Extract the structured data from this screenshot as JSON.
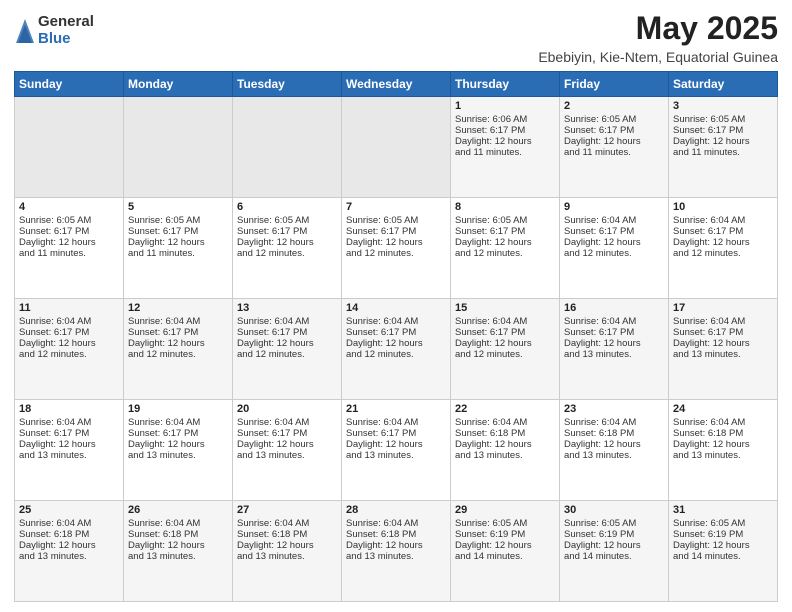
{
  "logo": {
    "general": "General",
    "blue": "Blue"
  },
  "title": "May 2025",
  "location": "Ebebiyin, Kie-Ntem, Equatorial Guinea",
  "days_of_week": [
    "Sunday",
    "Monday",
    "Tuesday",
    "Wednesday",
    "Thursday",
    "Friday",
    "Saturday"
  ],
  "weeks": [
    [
      {
        "day": "",
        "info": ""
      },
      {
        "day": "",
        "info": ""
      },
      {
        "day": "",
        "info": ""
      },
      {
        "day": "",
        "info": ""
      },
      {
        "day": "1",
        "info": "Sunrise: 6:06 AM\nSunset: 6:17 PM\nDaylight: 12 hours\nand 11 minutes."
      },
      {
        "day": "2",
        "info": "Sunrise: 6:05 AM\nSunset: 6:17 PM\nDaylight: 12 hours\nand 11 minutes."
      },
      {
        "day": "3",
        "info": "Sunrise: 6:05 AM\nSunset: 6:17 PM\nDaylight: 12 hours\nand 11 minutes."
      }
    ],
    [
      {
        "day": "4",
        "info": "Sunrise: 6:05 AM\nSunset: 6:17 PM\nDaylight: 12 hours\nand 11 minutes."
      },
      {
        "day": "5",
        "info": "Sunrise: 6:05 AM\nSunset: 6:17 PM\nDaylight: 12 hours\nand 11 minutes."
      },
      {
        "day": "6",
        "info": "Sunrise: 6:05 AM\nSunset: 6:17 PM\nDaylight: 12 hours\nand 12 minutes."
      },
      {
        "day": "7",
        "info": "Sunrise: 6:05 AM\nSunset: 6:17 PM\nDaylight: 12 hours\nand 12 minutes."
      },
      {
        "day": "8",
        "info": "Sunrise: 6:05 AM\nSunset: 6:17 PM\nDaylight: 12 hours\nand 12 minutes."
      },
      {
        "day": "9",
        "info": "Sunrise: 6:04 AM\nSunset: 6:17 PM\nDaylight: 12 hours\nand 12 minutes."
      },
      {
        "day": "10",
        "info": "Sunrise: 6:04 AM\nSunset: 6:17 PM\nDaylight: 12 hours\nand 12 minutes."
      }
    ],
    [
      {
        "day": "11",
        "info": "Sunrise: 6:04 AM\nSunset: 6:17 PM\nDaylight: 12 hours\nand 12 minutes."
      },
      {
        "day": "12",
        "info": "Sunrise: 6:04 AM\nSunset: 6:17 PM\nDaylight: 12 hours\nand 12 minutes."
      },
      {
        "day": "13",
        "info": "Sunrise: 6:04 AM\nSunset: 6:17 PM\nDaylight: 12 hours\nand 12 minutes."
      },
      {
        "day": "14",
        "info": "Sunrise: 6:04 AM\nSunset: 6:17 PM\nDaylight: 12 hours\nand 12 minutes."
      },
      {
        "day": "15",
        "info": "Sunrise: 6:04 AM\nSunset: 6:17 PM\nDaylight: 12 hours\nand 12 minutes."
      },
      {
        "day": "16",
        "info": "Sunrise: 6:04 AM\nSunset: 6:17 PM\nDaylight: 12 hours\nand 13 minutes."
      },
      {
        "day": "17",
        "info": "Sunrise: 6:04 AM\nSunset: 6:17 PM\nDaylight: 12 hours\nand 13 minutes."
      }
    ],
    [
      {
        "day": "18",
        "info": "Sunrise: 6:04 AM\nSunset: 6:17 PM\nDaylight: 12 hours\nand 13 minutes."
      },
      {
        "day": "19",
        "info": "Sunrise: 6:04 AM\nSunset: 6:17 PM\nDaylight: 12 hours\nand 13 minutes."
      },
      {
        "day": "20",
        "info": "Sunrise: 6:04 AM\nSunset: 6:17 PM\nDaylight: 12 hours\nand 13 minutes."
      },
      {
        "day": "21",
        "info": "Sunrise: 6:04 AM\nSunset: 6:17 PM\nDaylight: 12 hours\nand 13 minutes."
      },
      {
        "day": "22",
        "info": "Sunrise: 6:04 AM\nSunset: 6:18 PM\nDaylight: 12 hours\nand 13 minutes."
      },
      {
        "day": "23",
        "info": "Sunrise: 6:04 AM\nSunset: 6:18 PM\nDaylight: 12 hours\nand 13 minutes."
      },
      {
        "day": "24",
        "info": "Sunrise: 6:04 AM\nSunset: 6:18 PM\nDaylight: 12 hours\nand 13 minutes."
      }
    ],
    [
      {
        "day": "25",
        "info": "Sunrise: 6:04 AM\nSunset: 6:18 PM\nDaylight: 12 hours\nand 13 minutes."
      },
      {
        "day": "26",
        "info": "Sunrise: 6:04 AM\nSunset: 6:18 PM\nDaylight: 12 hours\nand 13 minutes."
      },
      {
        "day": "27",
        "info": "Sunrise: 6:04 AM\nSunset: 6:18 PM\nDaylight: 12 hours\nand 13 minutes."
      },
      {
        "day": "28",
        "info": "Sunrise: 6:04 AM\nSunset: 6:18 PM\nDaylight: 12 hours\nand 13 minutes."
      },
      {
        "day": "29",
        "info": "Sunrise: 6:05 AM\nSunset: 6:19 PM\nDaylight: 12 hours\nand 14 minutes."
      },
      {
        "day": "30",
        "info": "Sunrise: 6:05 AM\nSunset: 6:19 PM\nDaylight: 12 hours\nand 14 minutes."
      },
      {
        "day": "31",
        "info": "Sunrise: 6:05 AM\nSunset: 6:19 PM\nDaylight: 12 hours\nand 14 minutes."
      }
    ]
  ]
}
